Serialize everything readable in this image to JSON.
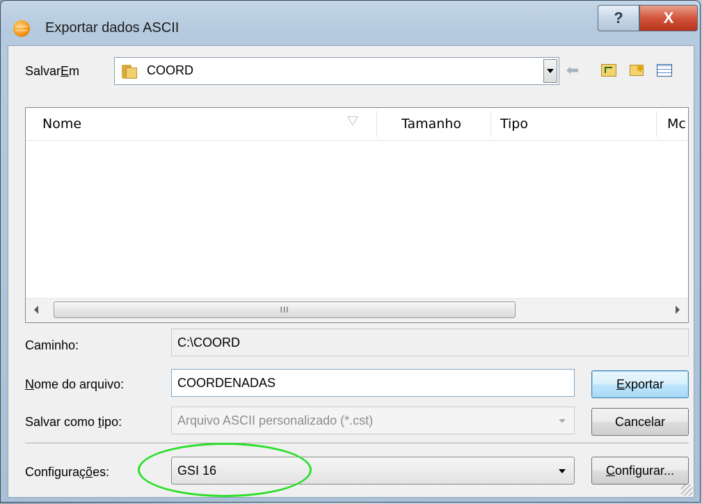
{
  "window": {
    "title": "Exportar dados ASCII",
    "help_glyph": "?",
    "close_glyph": "X"
  },
  "save_in": {
    "label_pre": "Salvar",
    "label_u": "E",
    "label_post": "m",
    "value": "COORD"
  },
  "list": {
    "columns": [
      "Nome",
      "Tamanho",
      "Tipo",
      "Mc"
    ],
    "scroll_thumb_glyph": "III"
  },
  "path": {
    "label": "Caminho:",
    "value": "C:\\COORD"
  },
  "filename": {
    "label_u": "N",
    "label_post": "ome do arquivo:",
    "value": "COORDENADAS"
  },
  "filetype": {
    "label_pre": "Salvar como ",
    "label_u": "t",
    "label_post": "ipo:",
    "value": "Arquivo ASCII personalizado (*.cst)"
  },
  "config": {
    "label_pre": "Configura",
    "label_u": "çõ",
    "label_post": "es:",
    "value": "GSI 16"
  },
  "buttons": {
    "export_u": "E",
    "export_post": "xportar",
    "cancel": "Cancelar",
    "configure_u": "C",
    "configure_post": "onfigurar..."
  },
  "colors": {
    "highlight_ellipse": "#2adf2a",
    "close_button": "#c9412a"
  }
}
